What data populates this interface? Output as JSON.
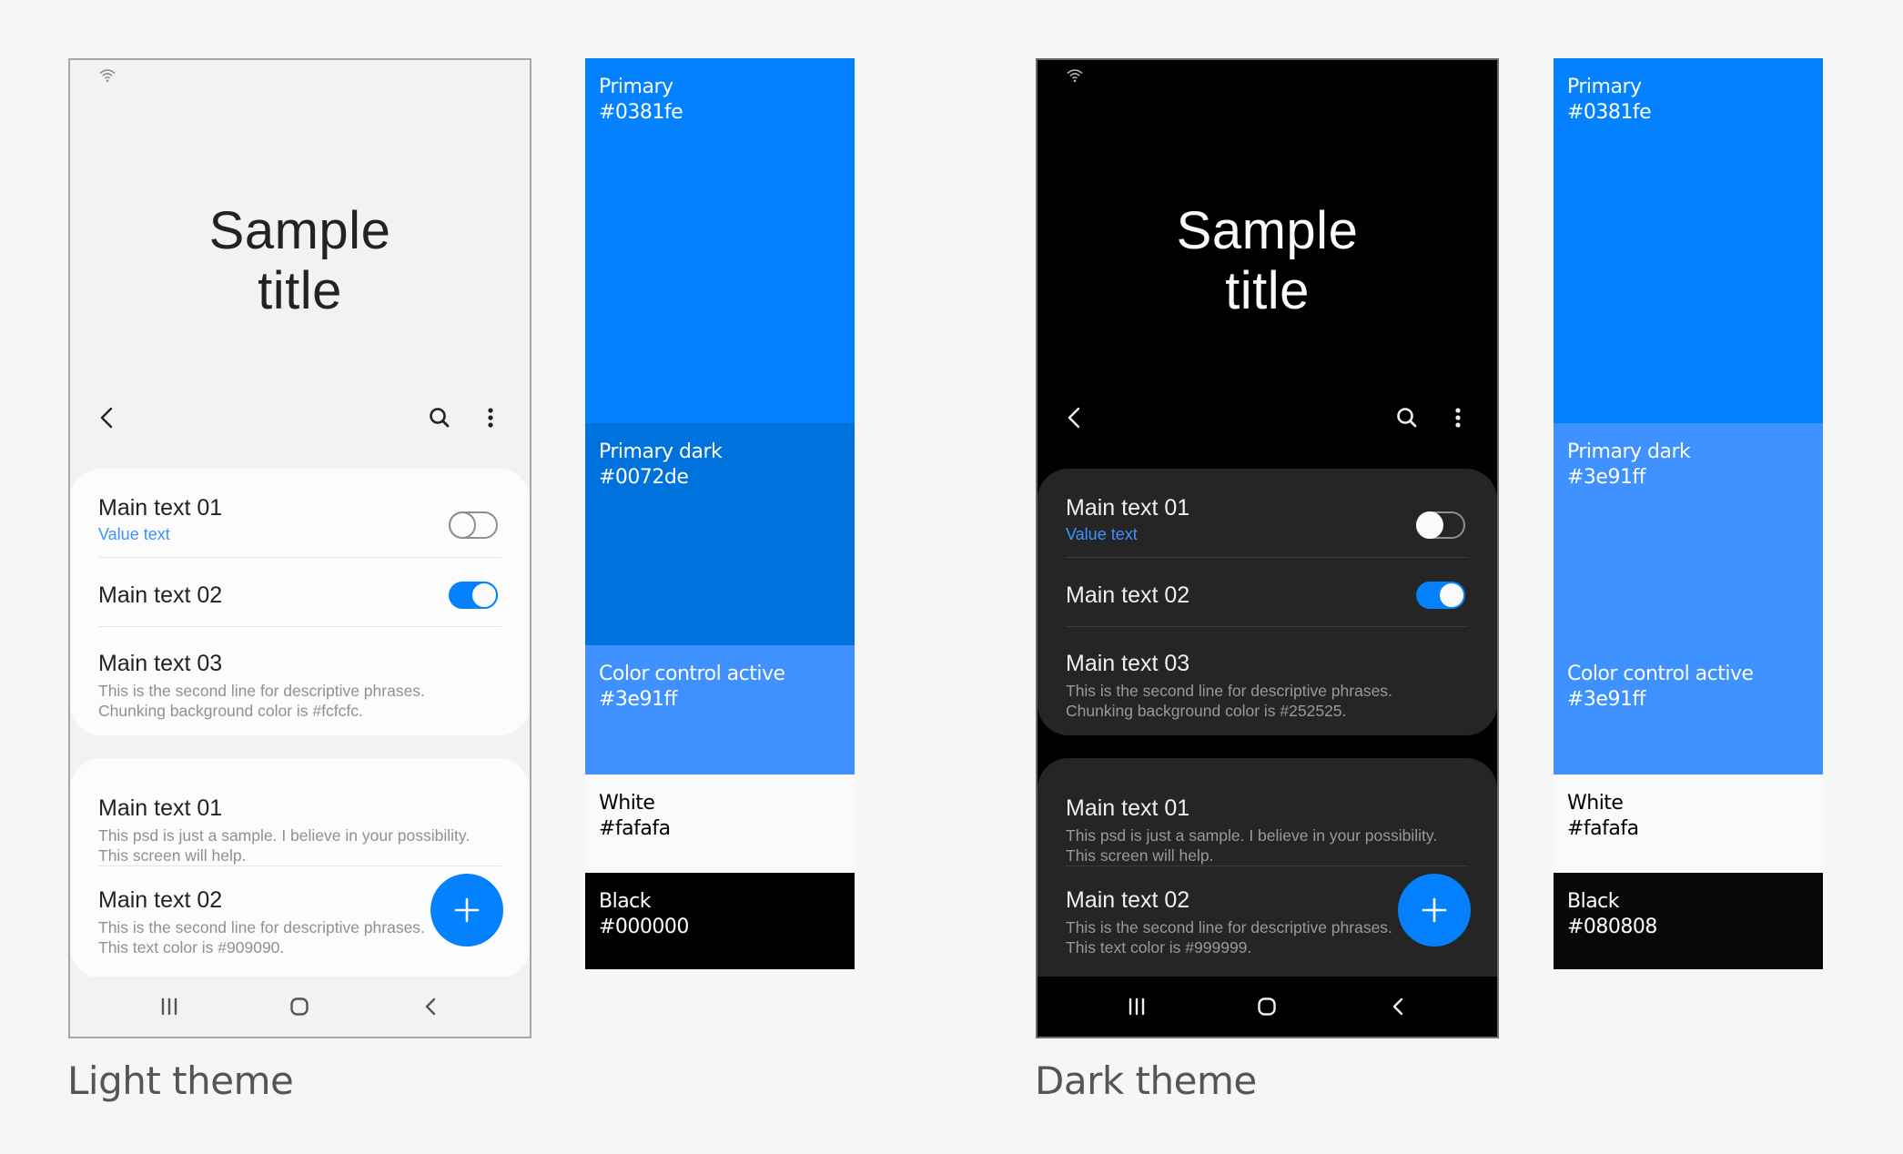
{
  "light_theme": {
    "label": "Light theme",
    "phone": {
      "title_line1": "Sample",
      "title_line2": "title",
      "appbar": {
        "back_icon": "back-chevron-icon",
        "search_icon": "search-icon",
        "more_icon": "more-vertical-icon"
      },
      "card1": [
        {
          "main": "Main text 01",
          "value": "Value text",
          "toggle": "off"
        },
        {
          "main": "Main text 02",
          "toggle": "on"
        },
        {
          "main": "Main text 03",
          "sub1": "This is the second line for descriptive phrases.",
          "sub2": "Chunking background color is #fcfcfc."
        }
      ],
      "card2": [
        {
          "main": "Main text 01",
          "sub1": "This psd is just a sample. I believe in your possibility.",
          "sub2": "This screen will help."
        },
        {
          "main": "Main text 02",
          "sub1": "This is the second line for descriptive phrases.",
          "sub2": "This text color is #909090."
        }
      ],
      "fab_icon": "plus-icon",
      "navbar": {
        "recents_icon": "recents-icon",
        "home_icon": "home-icon",
        "back_icon": "back-icon"
      }
    },
    "palette": [
      {
        "name": "Primary",
        "hex": "#0381fe",
        "color": "#0381fe",
        "text_color": "#ffffff"
      },
      {
        "name": "Primary dark",
        "hex": "#0072de",
        "color": "#0072de",
        "text_color": "#ffffff"
      },
      {
        "name": "Color control active",
        "hex": "#3e91ff",
        "color": "#3e91ff",
        "text_color": "#ffffff"
      },
      {
        "name": "White",
        "hex": "#fafafa",
        "color": "#fafafa",
        "text_color": "#000000"
      },
      {
        "name": "Black",
        "hex": "#000000",
        "color": "#000000",
        "text_color": "#ffffff"
      }
    ]
  },
  "dark_theme": {
    "label": "Dark theme",
    "phone": {
      "title_line1": "Sample",
      "title_line2": "title",
      "appbar": {
        "back_icon": "back-chevron-icon",
        "search_icon": "search-icon",
        "more_icon": "more-vertical-icon"
      },
      "card1": [
        {
          "main": "Main text 01",
          "value": "Value text",
          "toggle": "off"
        },
        {
          "main": "Main text 02",
          "toggle": "on"
        },
        {
          "main": "Main text 03",
          "sub1": "This is the second line for descriptive phrases.",
          "sub2": "Chunking background color is #252525."
        }
      ],
      "card2": [
        {
          "main": "Main text 01",
          "sub1": "This psd is just a sample. I believe in your possibility.",
          "sub2": "This screen will help."
        },
        {
          "main": "Main text 02",
          "sub1": "This is the second line for descriptive phrases.",
          "sub2": "This text color is #999999."
        }
      ],
      "fab_icon": "plus-icon",
      "navbar": {
        "recents_icon": "recents-icon",
        "home_icon": "home-icon",
        "back_icon": "back-icon"
      }
    },
    "palette": [
      {
        "name": "Primary",
        "hex": "#0381fe",
        "color": "#0381fe",
        "text_color": "#ffffff"
      },
      {
        "name": "Primary dark",
        "hex": "#3e91ff",
        "color": "#3e91ff",
        "text_color": "#ffffff"
      },
      {
        "name": "Color control active",
        "hex": "#3e91ff",
        "color": "#3e91ff",
        "text_color": "#ffffff"
      },
      {
        "name": "White",
        "hex": "#fafafa",
        "color": "#fafafa",
        "text_color": "#000000"
      },
      {
        "name": "Black",
        "hex": "#080808",
        "color": "#080808",
        "text_color": "#ffffff"
      }
    ]
  }
}
